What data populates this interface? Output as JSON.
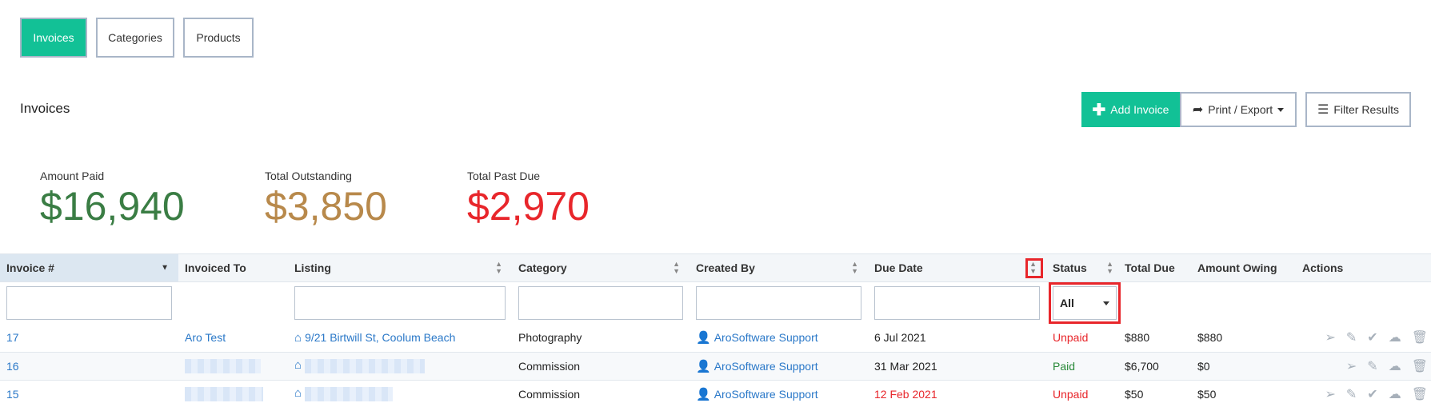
{
  "tabs": [
    {
      "label": "Invoices",
      "active": true
    },
    {
      "label": "Categories",
      "active": false
    },
    {
      "label": "Products",
      "active": false
    }
  ],
  "page_title": "Invoices",
  "toolbar": {
    "add_label": "Add Invoice",
    "print_label": "Print / Export",
    "filter_label": "Filter Results"
  },
  "stats": [
    {
      "label": "Amount Paid",
      "value": "$16,940",
      "color": "#3a7d44"
    },
    {
      "label": "Total Outstanding",
      "value": "$3,850",
      "color": "#b8894b"
    },
    {
      "label": "Total Past Due",
      "value": "$2,970",
      "color": "#e8262b"
    }
  ],
  "table": {
    "columns": [
      "Invoice #",
      "Invoiced To",
      "Listing",
      "Category",
      "Created By",
      "Due Date",
      "Status",
      "Total Due",
      "Amount Owing",
      "Actions"
    ],
    "status_filter": "All",
    "rows": [
      {
        "invoice": "17",
        "invoiced_to": "Aro Test",
        "listing": "9/21 Birtwill St, Coolum Beach",
        "category": "Photography",
        "created_by": "AroSoftware Support",
        "due_date": "6 Jul 2021",
        "status": "Unpaid",
        "total_due": "$880",
        "amount_owing": "$880"
      },
      {
        "invoice": "16",
        "invoiced_to": "",
        "listing": "",
        "category": "Commission",
        "created_by": "AroSoftware Support",
        "due_date": "31 Mar 2021",
        "status": "Paid",
        "total_due": "$6,700",
        "amount_owing": "$0"
      },
      {
        "invoice": "15",
        "invoiced_to": "",
        "listing": "",
        "category": "Commission",
        "created_by": "AroSoftware Support",
        "due_date": "12 Feb 2021",
        "status": "Unpaid",
        "total_due": "$50",
        "amount_owing": "$50"
      }
    ]
  }
}
